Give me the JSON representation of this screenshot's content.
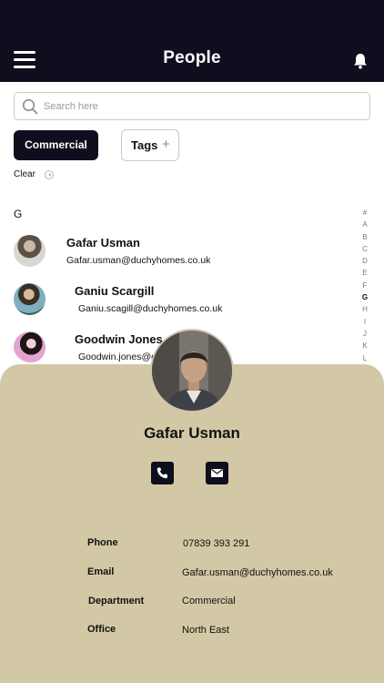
{
  "header": {
    "title": "People"
  },
  "search": {
    "placeholder": "Search here"
  },
  "filters": {
    "commercial": "Commercial",
    "tags": "Tags",
    "tags_plus": "+",
    "clear": "Clear"
  },
  "list": {
    "section": "G",
    "contacts": [
      {
        "name": "Gafar Usman",
        "email": "Gafar.usman@duchyhomes.co.uk"
      },
      {
        "name": "Ganiu Scargill",
        "email": "Ganiu.scagill@duchyhomes.co.uk"
      },
      {
        "name": "Goodwin Jones",
        "email": "Goodwin.jones@d"
      }
    ]
  },
  "alphabet_index": [
    "#",
    "A",
    "B",
    "C",
    "D",
    "E",
    "F",
    "G",
    "H",
    "I",
    "J",
    "K",
    "L"
  ],
  "alphabet_active": "G",
  "detail": {
    "name": "Gafar Usman",
    "fields": [
      {
        "label": "Phone",
        "value": "07839 393 291"
      },
      {
        "label": "Email",
        "value": "Gafar.usman@duchyhomes.co.uk"
      },
      {
        "label": "Department",
        "value": "Commercial"
      },
      {
        "label": "Office",
        "value": "North East"
      }
    ]
  },
  "icons": {
    "menu": "hamburger-menu-icon",
    "notifications": "bell-icon",
    "search": "search-icon",
    "clear": "clear-icon",
    "call": "phone-icon",
    "email": "mail-icon"
  },
  "colors": {
    "header_bg": "#0f0e1f",
    "sheet_bg": "#d3c8a5",
    "chip_active": "#0f0e1f"
  }
}
